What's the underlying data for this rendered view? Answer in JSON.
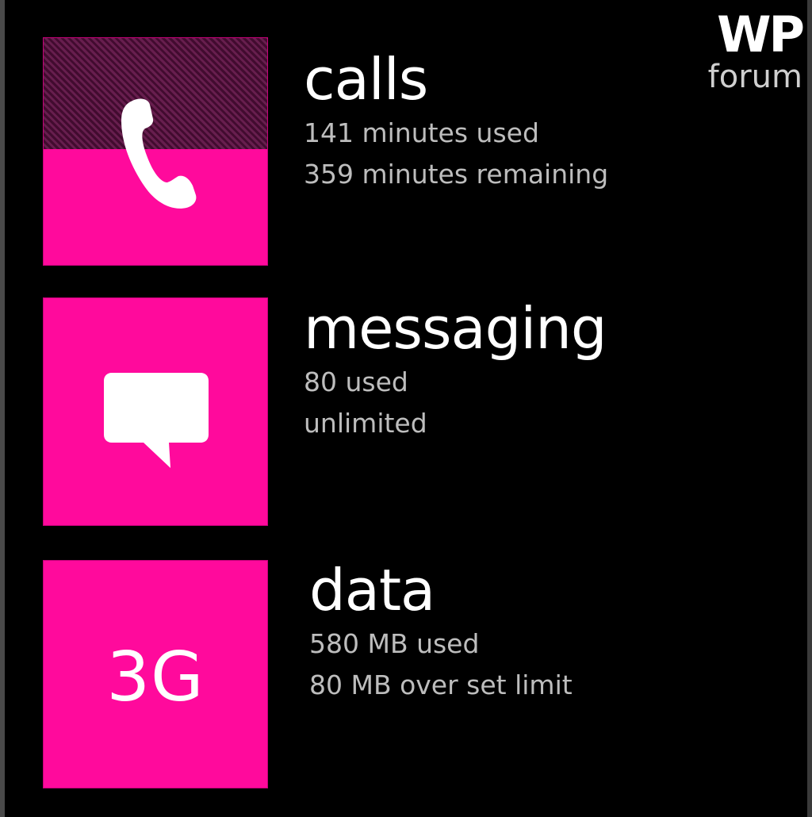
{
  "brand": {
    "logo_text": "WP",
    "sub_label": "forum"
  },
  "theme": {
    "accent_color": "#ff0a9c",
    "used_overlay_color": "#5e1043",
    "background_color": "#000000"
  },
  "sections": {
    "calls": {
      "title": "calls",
      "line1": "141 minutes used",
      "line2": "359 minutes remaining",
      "icon": "phone-icon",
      "used_fraction": 0.49
    },
    "messaging": {
      "title": "messaging",
      "line1": "80 used",
      "line2": "unlimited",
      "icon": "message-bubble-icon"
    },
    "data": {
      "title": "data",
      "line1": "580 MB used",
      "line2": "80 MB over set limit",
      "tile_label": "3G"
    }
  }
}
